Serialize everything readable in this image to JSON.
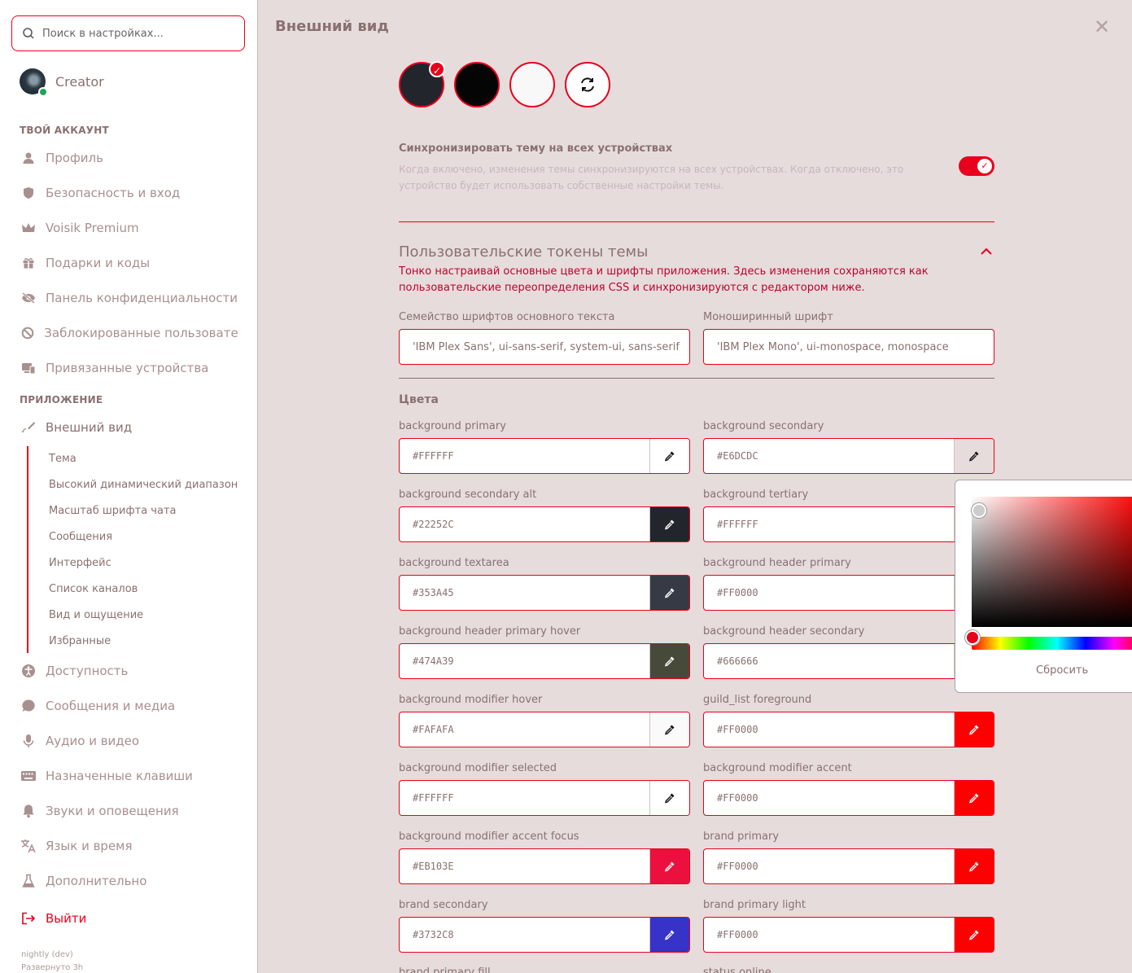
{
  "search": {
    "placeholder": "Поиск в настройках..."
  },
  "user": {
    "name": "Creator"
  },
  "sidebar": {
    "section_account": "ТВОЙ АККАУНТ",
    "account_items": [
      {
        "label": "Профиль",
        "icon": "user-icon"
      },
      {
        "label": "Безопасность и вход",
        "icon": "shield-icon"
      },
      {
        "label": "Voisik Premium",
        "icon": "crown-icon"
      },
      {
        "label": "Подарки и коды",
        "icon": "gift-icon"
      },
      {
        "label": "Панель конфиденциальности",
        "icon": "eye-off-icon"
      },
      {
        "label": "Заблокированные пользователи",
        "icon": "block-icon"
      },
      {
        "label": "Привязанные устройства",
        "icon": "devices-icon"
      }
    ],
    "section_app": "ПРИЛОЖЕНИЕ",
    "appearance": {
      "label": "Внешний вид",
      "icon": "brush-icon"
    },
    "sub_items": [
      "Тема",
      "Высокий динамический диапазон",
      "Масштаб шрифта чата",
      "Сообщения",
      "Интерфейс",
      "Список каналов",
      "Вид и ощущение",
      "Избранные"
    ],
    "app_items": [
      {
        "label": "Доступность",
        "icon": "accessibility-icon"
      },
      {
        "label": "Сообщения и медиа",
        "icon": "chat-icon"
      },
      {
        "label": "Аудио и видео",
        "icon": "mic-icon"
      },
      {
        "label": "Назначенные клавиши",
        "icon": "keyboard-icon"
      },
      {
        "label": "Звуки и оповещения",
        "icon": "bell-icon"
      },
      {
        "label": "Язык и время",
        "icon": "translate-icon"
      },
      {
        "label": "Дополнительно",
        "icon": "flask-icon"
      }
    ],
    "logout": {
      "label": "Выйти",
      "icon": "logout-icon"
    },
    "footer": {
      "build": "nightly (dev)",
      "deployed": "Развернуто 3h"
    }
  },
  "main": {
    "title": "Внешний вид",
    "theme_swatches": [
      {
        "name": "dark",
        "color": "#22252C",
        "selected": true
      },
      {
        "name": "black",
        "color": "#050505",
        "selected": false
      },
      {
        "name": "light",
        "color": "#F8F8F8",
        "selected": false
      },
      {
        "name": "sync",
        "icon": "sync-icon"
      }
    ],
    "sync": {
      "title": "Синхронизировать тему на всех устройствах",
      "description": "Когда включено, изменения темы синхронизируются на всех устройствах. Когда отключено, это устройство будет использовать собственные настройки темы.",
      "enabled": true
    },
    "tokens": {
      "title": "Пользовательские токены темы",
      "description": "Тонко настраивай основные цвета и шрифты приложения. Здесь изменения сохраняются как пользовательские переопределения CSS и синхронизируются с редактором ниже.",
      "font_body_label": "Семейство шрифтов основного текста",
      "font_body_value": "'IBM Plex Sans', ui-sans-serif, system-ui, sans-serif",
      "font_mono_label": "Моноширинный шрифт",
      "font_mono_value": "'IBM Plex Mono', ui-monospace, monospace"
    },
    "colors_title": "Цвета",
    "colors": [
      {
        "label": "background primary",
        "value": "#FFFFFF",
        "swatch": "#FFFFFF"
      },
      {
        "label": "background secondary",
        "value": "#E6DCDC",
        "swatch": "#E6DCDC"
      },
      {
        "label": "background secondary alt",
        "value": "#22252C",
        "swatch": "#22252C"
      },
      {
        "label": "background tertiary",
        "value": "#FFFFFF",
        "swatch": "#FFFFFF"
      },
      {
        "label": "background textarea",
        "value": "#353A45",
        "swatch": "#353A45"
      },
      {
        "label": "background header primary",
        "value": "#FF0000",
        "swatch": "#FF0000"
      },
      {
        "label": "background header primary hover",
        "value": "#474A39",
        "swatch": "#474A39"
      },
      {
        "label": "background header secondary",
        "value": "#666666",
        "swatch": "#666666"
      },
      {
        "label": "background modifier hover",
        "value": "#FAFAFA",
        "swatch": "#FAFAFA"
      },
      {
        "label": "guild_list foreground",
        "value": "#FF0000",
        "swatch": "#FF0000"
      },
      {
        "label": "background modifier selected",
        "value": "#FFFFFF",
        "swatch": "#FFFFFF"
      },
      {
        "label": "background modifier accent",
        "value": "#FF0000",
        "swatch": "#FF0000"
      },
      {
        "label": "background modifier accent focus",
        "value": "#EB103E",
        "swatch": "#EB103E"
      },
      {
        "label": "brand primary",
        "value": "#FF0000",
        "swatch": "#FF0000"
      },
      {
        "label": "brand secondary",
        "value": "#3732C8",
        "swatch": "#3732C8"
      },
      {
        "label": "brand primary light",
        "value": "#FF0000",
        "swatch": "#FF0000"
      }
    ],
    "partial_labels": [
      "brand primary fill",
      "status online"
    ],
    "picker": {
      "reset_label": "Сбросить",
      "color": "#FF0000"
    }
  },
  "theme": {
    "accent": "#E8001C",
    "text_muted": "#8A7070"
  }
}
